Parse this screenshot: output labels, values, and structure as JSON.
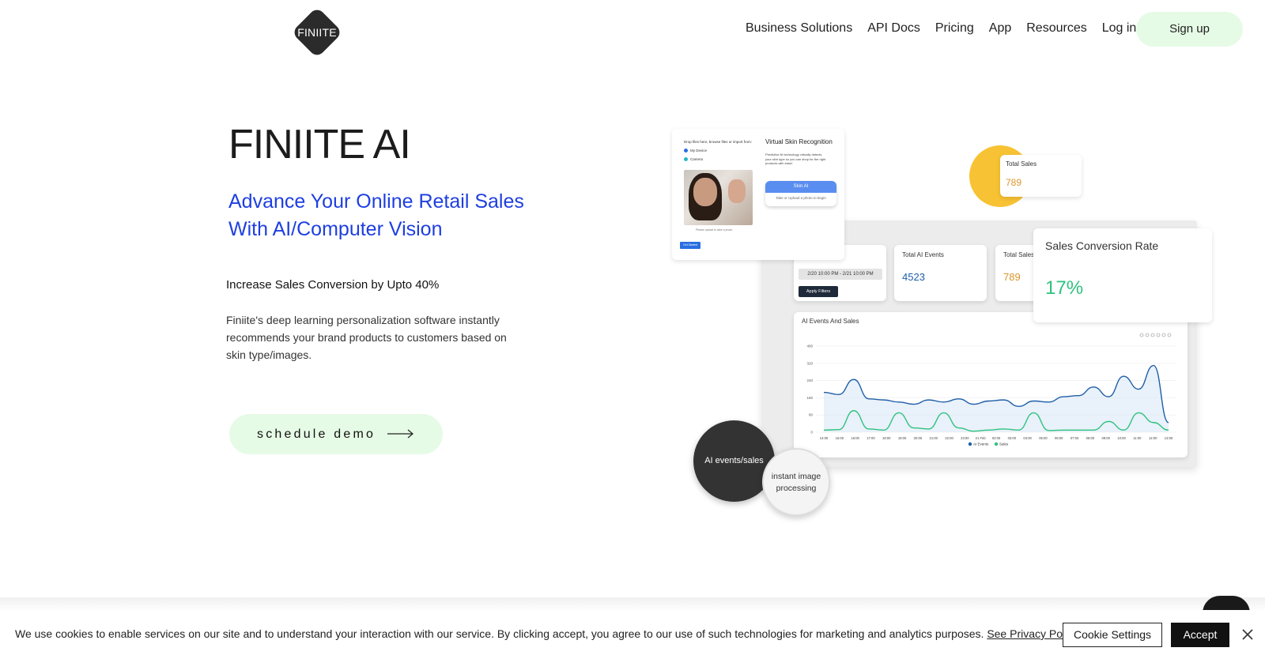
{
  "header": {
    "logo_text": "FINIITE",
    "nav": [
      "Business Solutions",
      "API Docs",
      "Pricing",
      "App",
      "Resources",
      "Log in"
    ],
    "signup_label": "Sign up"
  },
  "hero": {
    "title": "FINIITE AI",
    "subtitle_line1": "Advance Your Online Retail Sales",
    "subtitle_line2": "With AI/Computer Vision",
    "highlight": "Increase Sales Conversion by Upto 40%",
    "description": "Finiite's deep learning personalization software instantly recommends your brand products to customers based on skin type/images.",
    "cta_label": "schedule demo"
  },
  "illustration": {
    "skin_card": {
      "upload_text": "Drop files here, browse files or import from:",
      "option_device": "My Device",
      "option_camera": "Camera",
      "title": "Virtual Skin Recognition",
      "desc": "Predictive AI technology virtually detects your skin type so you can shop for the right products with ease!",
      "button": "Skin AI",
      "button_hint": "Take or Upload a photo to begin",
      "photo_caption": "Please upload to take a photo",
      "start_button": "Get Started"
    },
    "total_sales_top": {
      "label": "Total Sales",
      "value": "789"
    },
    "date_card": {
      "range": "2/20 10:00 PM - 2/21 10:00 PM",
      "apply": "Apply Filters"
    },
    "ai_events_card": {
      "label": "Total AI Events",
      "value": "4523"
    },
    "total_sales_card": {
      "label": "Total Sales",
      "value": "789"
    },
    "sales_rate": {
      "label": "Sales Conversion Rate",
      "value": "17%"
    },
    "circle_dark": "AI events/sales",
    "circle_light_line1": "instant image",
    "circle_light_line2": "processing",
    "colors": {
      "ai_events": "#1f5fa8",
      "sales": "#2ec27e",
      "rate": "#2ec27e",
      "total_sales": "#d9972b"
    }
  },
  "chart_data": {
    "type": "line",
    "title": "AI Events And Sales",
    "x": [
      "14:00",
      "15:00",
      "16:00",
      "17:00",
      "18:00",
      "19:00",
      "20:00",
      "21:00",
      "22:00",
      "23:00",
      "21 Feb",
      "02:00",
      "03:00",
      "04:00",
      "05:00",
      "06:00",
      "07:00",
      "08:00",
      "09:00",
      "10:00",
      "11:00",
      "12:00",
      "13:00"
    ],
    "yticks": [
      "0",
      "80",
      "160",
      "240",
      "320",
      "400"
    ],
    "ylim": [
      0,
      400
    ],
    "series": [
      {
        "name": "AI Events",
        "values": [
          185,
          175,
          245,
          155,
          150,
          140,
          130,
          150,
          140,
          155,
          130,
          145,
          150,
          120,
          145,
          140,
          165,
          170,
          210,
          165,
          260,
          200,
          310,
          45
        ]
      },
      {
        "name": "Sales",
        "values": [
          10,
          12,
          100,
          15,
          10,
          90,
          20,
          15,
          90,
          20,
          5,
          10,
          15,
          10,
          90,
          8,
          10,
          10,
          10,
          50,
          10,
          90,
          45,
          10
        ]
      }
    ],
    "legend": [
      "AI Events",
      "Sales"
    ]
  },
  "cookie": {
    "text": "We use cookies to enable services on our site and to understand your interaction with our service. By clicking accept, you agree to our use of such technologies for marketing and analytics purposes.",
    "link": "See Privacy Policy",
    "settings": "Cookie Settings",
    "accept": "Accept"
  }
}
